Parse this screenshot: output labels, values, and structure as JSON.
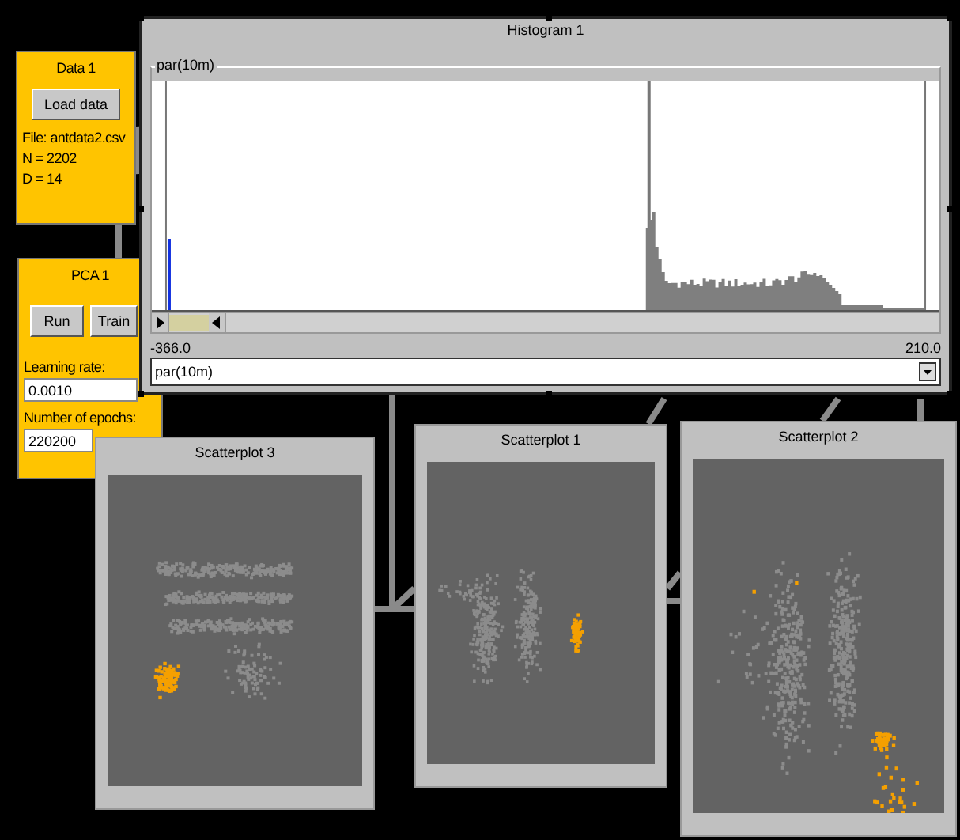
{
  "nodes": [
    {
      "kind": "data",
      "title": "Data 1",
      "button": "Load data",
      "lines": [
        "File: antdata2.csv",
        "N = 2202",
        "D = 14"
      ]
    },
    {
      "kind": "pca",
      "title": "PCA 1",
      "buttons": [
        "Run",
        "Train"
      ],
      "fields": [
        {
          "label": "Learning rate:",
          "value": "0.0010"
        },
        {
          "label": "Number of epochs:",
          "value": "220200"
        }
      ]
    }
  ],
  "histogram": {
    "title": "Histogram 1",
    "group_label": "par(10m)",
    "min_label": "-366.0",
    "max_label": "210.0",
    "selected_variable": "par(10m)",
    "slider": {
      "level": 0.05
    }
  },
  "scatterplots": [
    {
      "title": "Scatterplot 3"
    },
    {
      "title": "Scatterplot 1"
    },
    {
      "title": "Scatterplot 2"
    }
  ]
}
